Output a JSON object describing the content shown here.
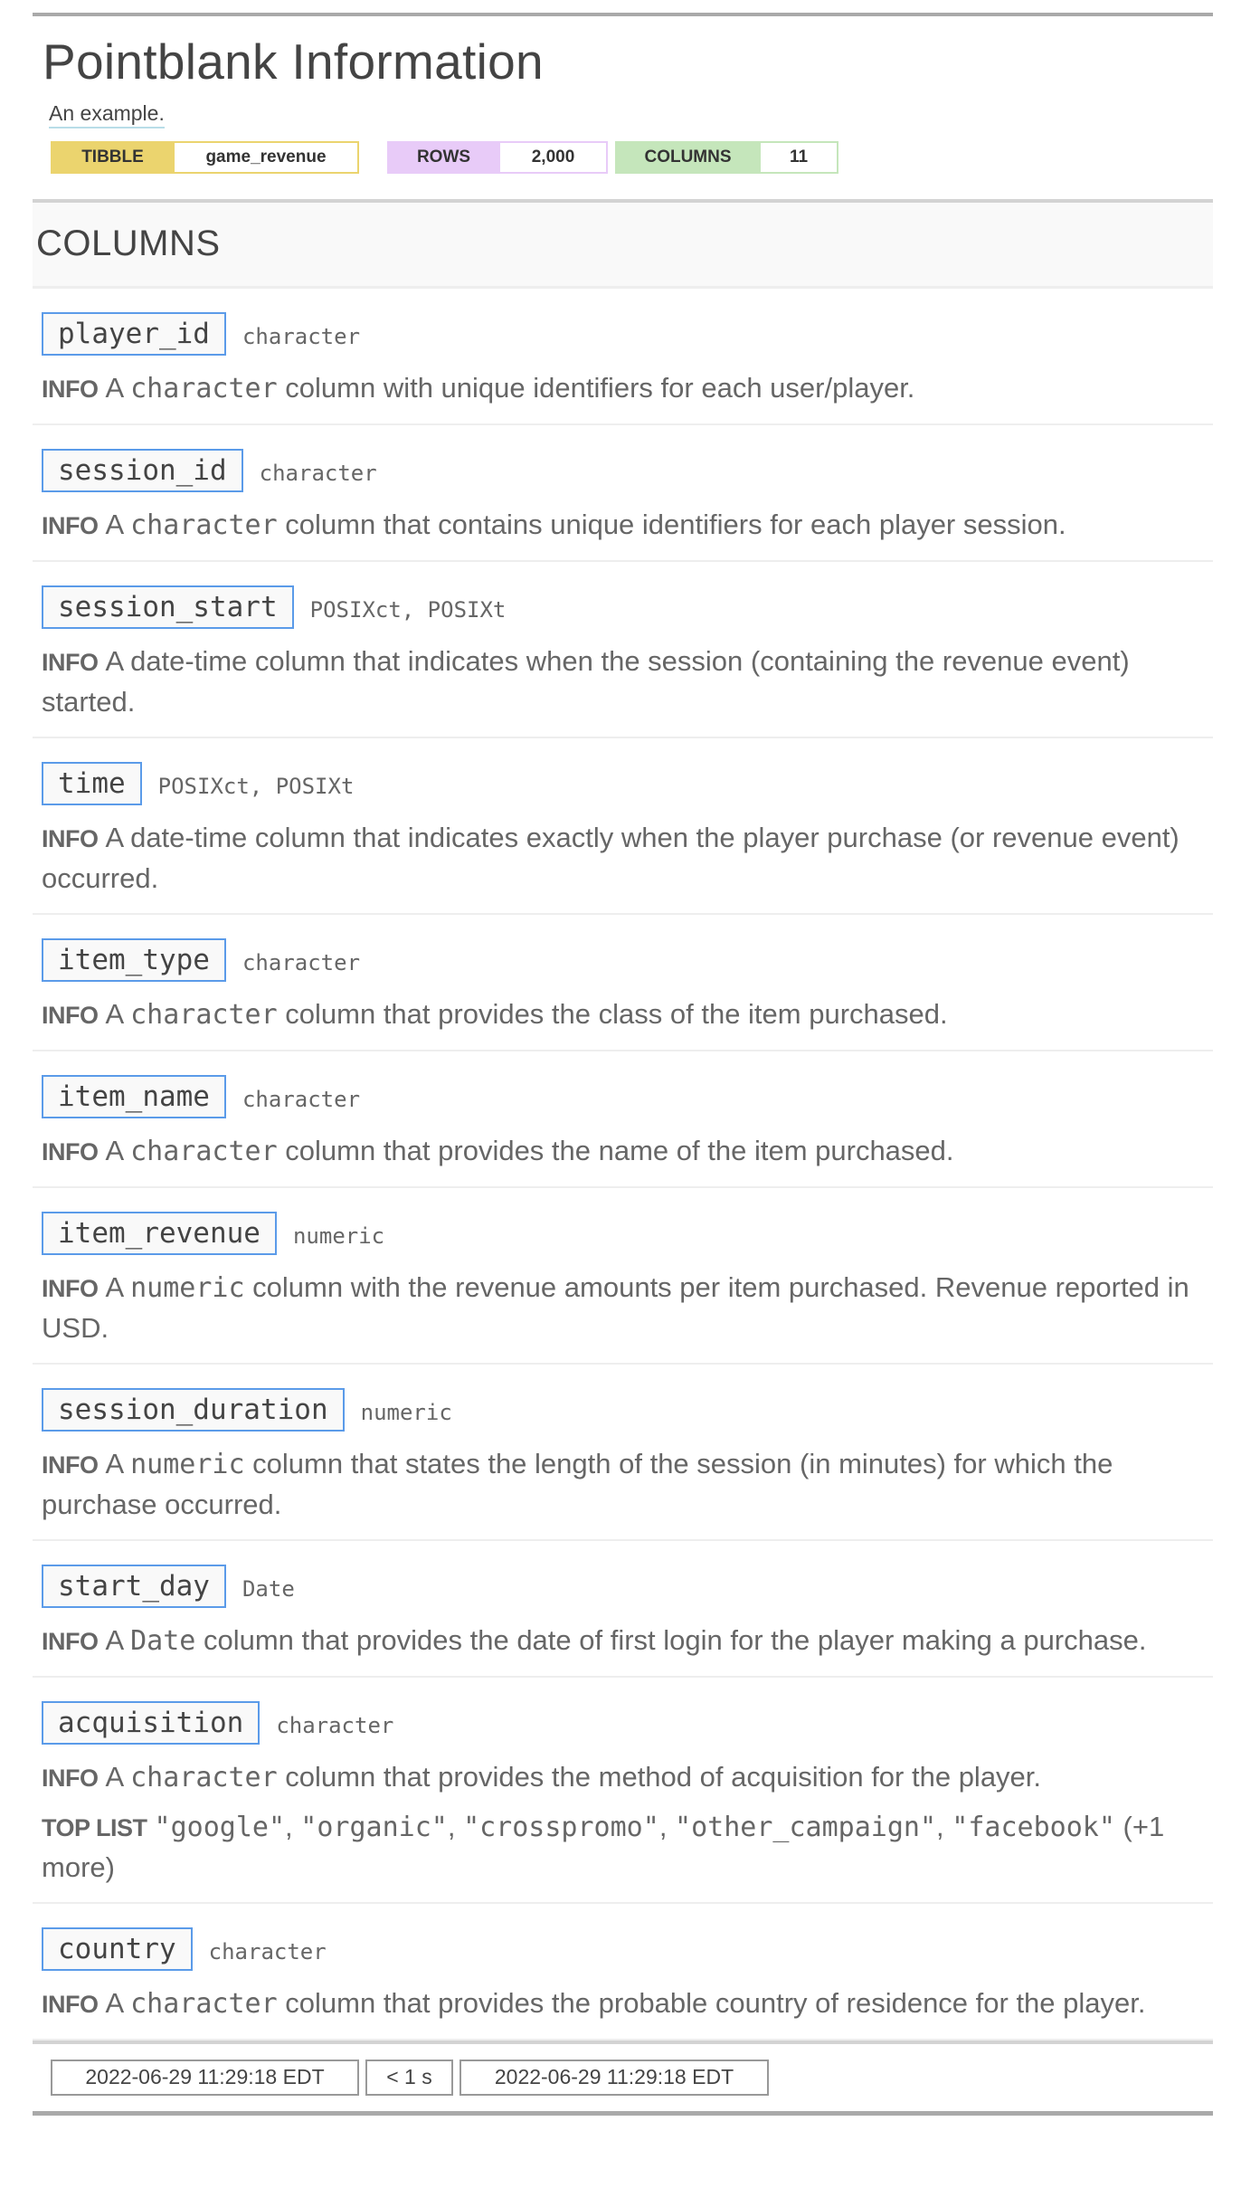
{
  "header": {
    "title": "Pointblank Information",
    "subtitle": "An example."
  },
  "badges": {
    "tibble": {
      "label": "TIBBLE",
      "value": "game_revenue"
    },
    "rows": {
      "label": "ROWS",
      "value": "2,000"
    },
    "columns": {
      "label": "COLUMNS",
      "value": "11"
    }
  },
  "section": {
    "title": "COLUMNS"
  },
  "labels": {
    "info": "INFO",
    "top_list": "TOP LIST"
  },
  "columns": [
    {
      "name": "player_id",
      "type": "character",
      "info": [
        {
          "t": "A "
        },
        {
          "c": "character"
        },
        {
          "t": " column with unique identifiers for each user/player."
        }
      ]
    },
    {
      "name": "session_id",
      "type": "character",
      "info": [
        {
          "t": "A "
        },
        {
          "c": "character"
        },
        {
          "t": " column that contains unique identifiers for each player session."
        }
      ]
    },
    {
      "name": "session_start",
      "type": "POSIXct, POSIXt",
      "info": [
        {
          "t": "A date-time column that indicates when the session (containing the revenue event) started."
        }
      ]
    },
    {
      "name": "time",
      "type": "POSIXct, POSIXt",
      "info": [
        {
          "t": "A date-time column that indicates exactly when the player purchase (or revenue event) occurred."
        }
      ]
    },
    {
      "name": "item_type",
      "type": "character",
      "info": [
        {
          "t": "A "
        },
        {
          "c": "character"
        },
        {
          "t": " column that provides the class of the item purchased."
        }
      ]
    },
    {
      "name": "item_name",
      "type": "character",
      "info": [
        {
          "t": "A "
        },
        {
          "c": "character"
        },
        {
          "t": " column that provides the name of the item purchased."
        }
      ]
    },
    {
      "name": "item_revenue",
      "type": "numeric",
      "info": [
        {
          "t": "A "
        },
        {
          "c": "numeric"
        },
        {
          "t": " column with the revenue amounts per item purchased. Revenue reported in USD."
        }
      ]
    },
    {
      "name": "session_duration",
      "type": "numeric",
      "info": [
        {
          "t": "A "
        },
        {
          "c": "numeric"
        },
        {
          "t": " column that states the length of the session (in minutes) for which the purchase occurred."
        }
      ]
    },
    {
      "name": "start_day",
      "type": "Date",
      "info": [
        {
          "t": "A "
        },
        {
          "c": "Date"
        },
        {
          "t": " column that provides the date of first login for the player making a purchase."
        }
      ]
    },
    {
      "name": "acquisition",
      "type": "character",
      "info": [
        {
          "t": "A "
        },
        {
          "c": "character"
        },
        {
          "t": " column that provides the method of acquisition for the player."
        }
      ],
      "top_list": {
        "items": [
          "\"google\"",
          "\"organic\"",
          "\"crosspromo\"",
          "\"other_campaign\"",
          "\"facebook\""
        ],
        "more": "(+1 more)"
      }
    },
    {
      "name": "country",
      "type": "character",
      "info": [
        {
          "t": "A "
        },
        {
          "c": "character"
        },
        {
          "t": " column that provides the probable country of residence for the player."
        }
      ]
    }
  ],
  "footer": {
    "start_time": "2022-06-29 11:29:18 EDT",
    "duration": "< 1 s",
    "end_time": "2022-06-29 11:29:18 EDT"
  }
}
